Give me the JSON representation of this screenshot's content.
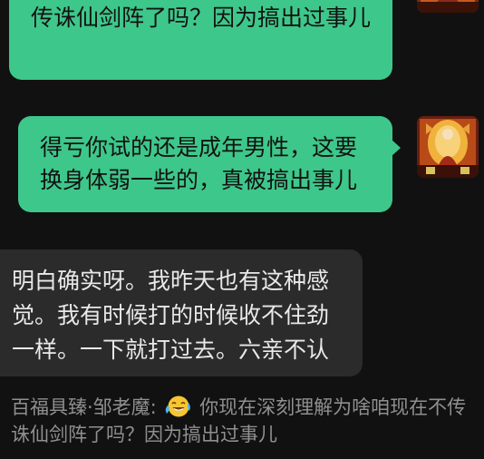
{
  "messages": [
    {
      "id": "m1",
      "direction": "out",
      "text": "传诛仙剑阵了吗？因为搞出过事儿"
    },
    {
      "id": "m2",
      "direction": "out",
      "text": "得亏你试的还是成年男性，这要换身体弱一些的，真被搞出事儿"
    },
    {
      "id": "m3",
      "direction": "in",
      "text": "明白确实呀。我昨天也有这种感觉。我有时候打的时候收不住劲一样。一下就打过去。六亲不认"
    }
  ],
  "quote": {
    "sender": "百福具臻·邹老魔:",
    "emoji": "crying-laughing-emoji",
    "text": "你现在深刻理解为啥咱现在不传诛仙剑阵了吗？因为搞出过事儿"
  },
  "colors": {
    "background": "#111111",
    "outgoing_bubble": "#3ec78b",
    "incoming_bubble": "#2b2b2b",
    "quote_text": "#8f8f8f"
  }
}
